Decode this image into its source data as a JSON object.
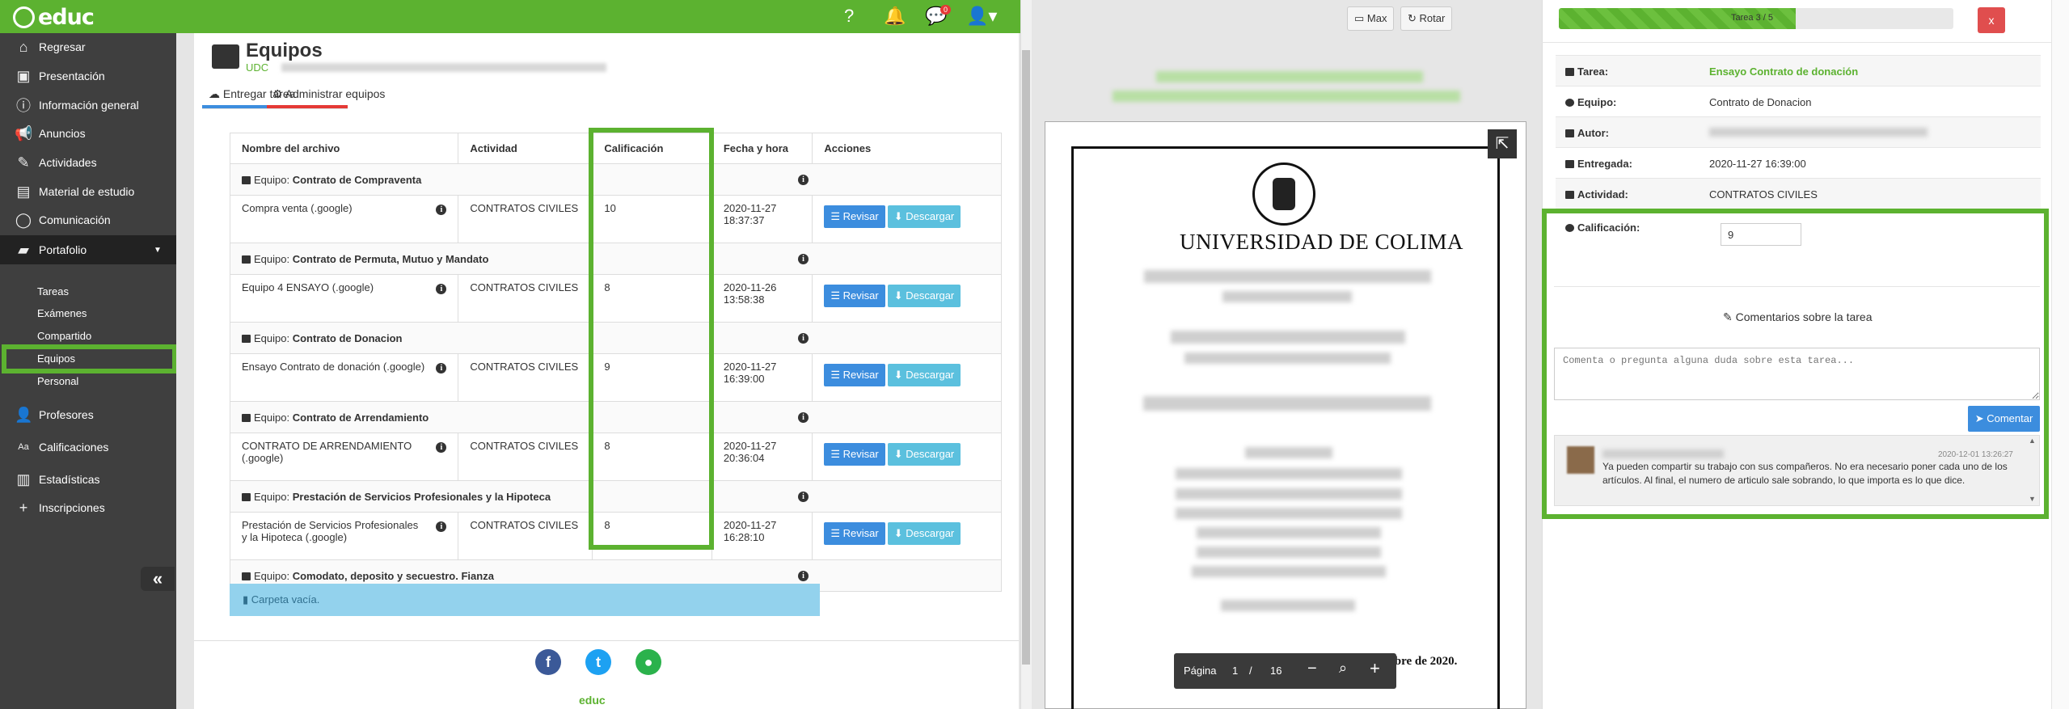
{
  "app": {
    "logo": "educ",
    "notif_badge": "0"
  },
  "sidebar": {
    "items": [
      {
        "label": "Regresar",
        "icon": "home-icon"
      },
      {
        "label": "Presentación",
        "icon": "presentation-icon"
      },
      {
        "label": "Información general",
        "icon": "info-icon"
      },
      {
        "label": "Anuncios",
        "icon": "megaphone-icon"
      },
      {
        "label": "Actividades",
        "icon": "pencil-icon"
      },
      {
        "label": "Material de estudio",
        "icon": "document-icon"
      },
      {
        "label": "Comunicación",
        "icon": "chat-icon"
      },
      {
        "label": "Portafolio",
        "icon": "folder-icon"
      }
    ],
    "portafolio_sub": [
      "Tareas",
      "Exámenes",
      "Compartido",
      "Equipos",
      "Personal"
    ],
    "bottom_items": [
      {
        "label": "Profesores",
        "icon": "user-icon"
      },
      {
        "label": "Calificaciones",
        "icon": "grades-icon"
      },
      {
        "label": "Estadísticas",
        "icon": "bar-chart-icon"
      },
      {
        "label": "Inscripciones",
        "icon": "plus-icon"
      }
    ],
    "collapse_glyph": "«"
  },
  "page": {
    "title": "Equipos",
    "subtitle": "UDC",
    "tabs": [
      "Entregar tarea",
      "Administrar equipos"
    ]
  },
  "table": {
    "headers": [
      "Nombre del archivo",
      "Actividad",
      "Calificación",
      "Fecha y hora",
      "Acciones"
    ],
    "group_prefix": "Equipo:",
    "rows": [
      {
        "group": "Contrato de Compraventa",
        "file": "Compra venta (.google)",
        "activity": "CONTRATOS CIVILES",
        "grade": "10",
        "date": "2020-11-27",
        "time": "18:37:37"
      },
      {
        "group": "Contrato de Permuta, Mutuo y Mandato",
        "file": "Equipo 4 ENSAYO (.google)",
        "activity": "CONTRATOS CIVILES",
        "grade": "8",
        "date": "2020-11-26",
        "time": "13:58:38"
      },
      {
        "group": "Contrato de Donacion",
        "file": "Ensayo Contrato de donación (.google)",
        "activity": "CONTRATOS CIVILES",
        "grade": "9",
        "date": "2020-11-27",
        "time": "16:39:00"
      },
      {
        "group": "Contrato de Arrendamiento",
        "file": "CONTRATO DE ARRENDAMIENTO (.google)",
        "activity": "CONTRATOS CIVILES",
        "grade": "8",
        "date": "2020-11-27",
        "time": "20:36:04"
      },
      {
        "group": "Prestación de Servicios Profesionales y la Hipoteca",
        "file": "Prestación de Servicios Profesionales y la Hipoteca (.google)",
        "activity": "CONTRATOS CIVILES",
        "grade": "8",
        "date": "2020-11-27",
        "time": "16:28:10"
      }
    ],
    "last_group": "Comodato, deposito y secuestro. Fianza",
    "empty_folder": "Carpeta vacía.",
    "btn_review": "Revisar",
    "btn_download": "Descargar"
  },
  "footer": {
    "logo": "educ"
  },
  "viewer": {
    "btn_max": "Max",
    "btn_rotate": "Rotar",
    "doc_university": "UNIVERSIDAD DE COLIMA",
    "doc_date_line": "Fecha de entrega: 27 de noviembre de 2020.",
    "pager_label": "Página",
    "page_current": "1",
    "page_sep": "/",
    "page_total": "16"
  },
  "panel": {
    "progress_label": "Tarea 3 / 5",
    "progress_fraction": 0.6,
    "close_label": "x",
    "details": [
      {
        "key": "Tarea:",
        "value": "Ensayo Contrato de donación"
      },
      {
        "key": "Equipo:",
        "value": "Contrato de Donacion"
      },
      {
        "key": "Autor:",
        "value": ""
      },
      {
        "key": "Entregada:",
        "value": "2020-11-27 16:39:00"
      },
      {
        "key": "Actividad:",
        "value": "CONTRATOS CIVILES"
      }
    ],
    "grade_label": "Calificación:",
    "grade_value": "9",
    "comments_title": "Comentarios sobre la tarea",
    "comment_placeholder": "Comenta o pregunta alguna duda sobre esta tarea...",
    "comment_button": "Comentar",
    "comment": {
      "date": "2020-12-01 13:26:27",
      "text": "Ya pueden compartir su trabajo con sus compañeros. No era necesario poner cada uno de los artículos. Al final, el numero de articulo sale sobrando, lo que importa es lo que dice."
    }
  },
  "colors": {
    "brand": "#5cb230",
    "sidebar": "#3f3f3f",
    "primary": "#3c8dde",
    "info": "#5bc0de",
    "danger": "#e04e4e"
  }
}
